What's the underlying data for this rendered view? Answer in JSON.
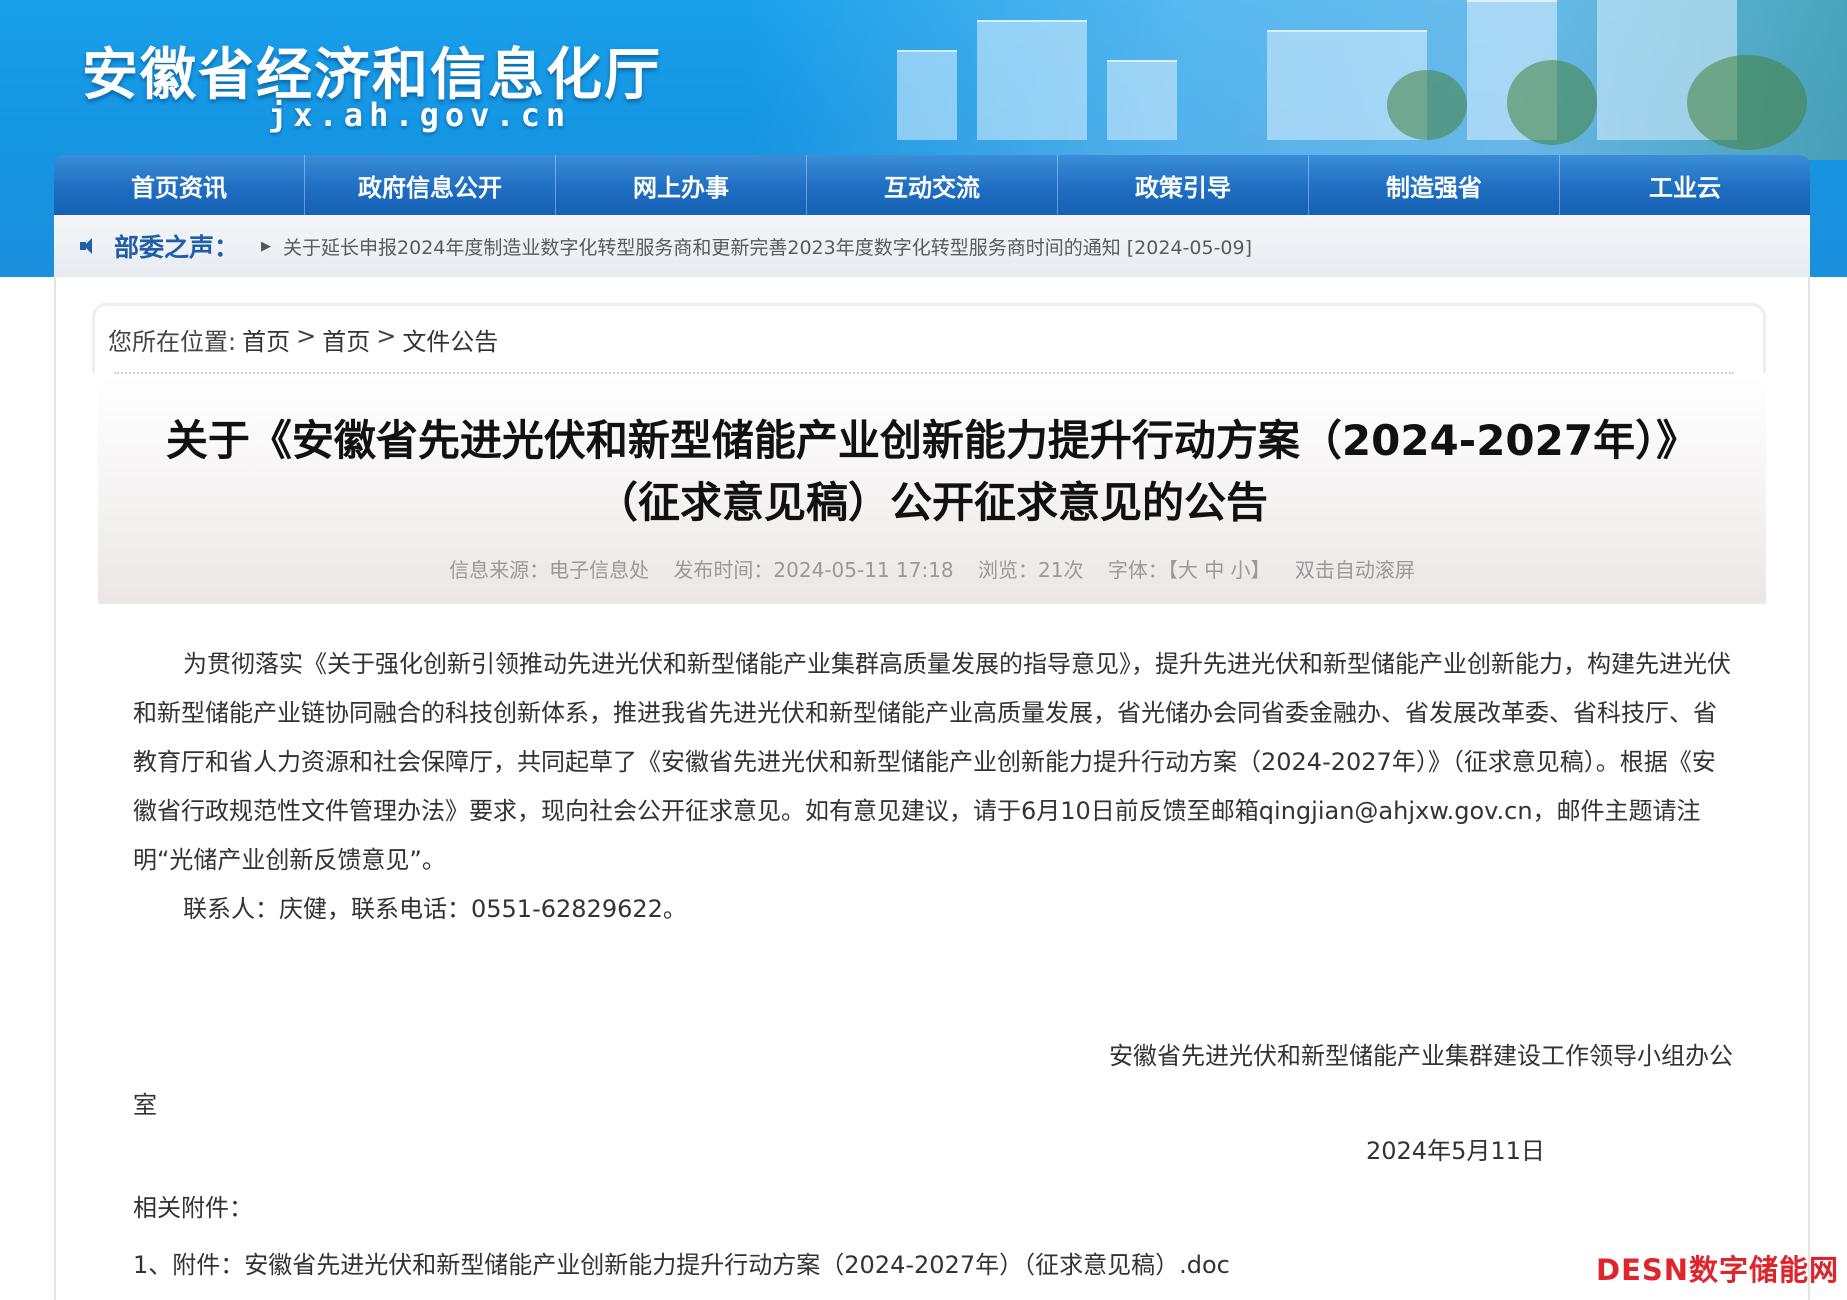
{
  "header": {
    "site_title": "安徽省经济和信息化厅",
    "site_domain": "jx.ah.gov.cn"
  },
  "nav": {
    "items": [
      "首页资讯",
      "政府信息公开",
      "网上办事",
      "互动交流",
      "政策引导",
      "制造强省",
      "工业云"
    ]
  },
  "notice": {
    "label": "部委之声：",
    "text": "关于延长申报2024年度制造业数字化转型服务商和更新完善2023年度数字化转型服务商时间的通知 [2024-05-09]"
  },
  "breadcrumb": {
    "prefix": "您所在位置:",
    "items": [
      "首页",
      "首页",
      "文件公告"
    ],
    "separator": ">"
  },
  "article": {
    "title_line1": "关于《安徽省先进光伏和新型储能产业创新能力提升行动方案（2024-2027年）》",
    "title_line2": "（征求意见稿）公开征求意见的公告",
    "meta": {
      "source": "信息来源：电子信息处",
      "published": "发布时间：2024-05-11 17:18",
      "views": "浏览：21次",
      "font_label": "字体：",
      "font_sizes": "【大 中 小】",
      "autoscroll": "双击自动滚屏"
    },
    "para1": "为贯彻落实《关于强化创新引领推动先进光伏和新型储能产业集群高质量发展的指导意见》，提升先进光伏和新型储能产业创新能力，构建先进光伏和新型储能产业链协同融合的科技创新体系，推进我省先进光伏和新型储能产业高质量发展，省光储办会同省委金融办、省发展改革委、省科技厅、省教育厅和省人力资源和社会保障厅，共同起草了《安徽省先进光伏和新型储能产业创新能力提升行动方案（2024-2027年）》（征求意见稿）。根据《安徽省行政规范性文件管理办法》要求，现向社会公开征求意见。如有意见建议，请于6月10日前反馈至邮箱qingjian@ahjxw.gov.cn，邮件主题请注明“光储产业创新反馈意见”。",
    "para2": "联系人：庆健，联系电话：0551-62829622。",
    "signature_line1": "安徽省先进光伏和新型储能产业集群建设工作领导小组办公",
    "signature_line2": "室",
    "date": "2024年5月11日",
    "attachments_label": "相关附件：",
    "attachments": [
      "1、附件：安徽省先进光伏和新型储能产业创新能力提升行动方案（2024-2027年）（征求意见稿）.doc"
    ]
  },
  "watermark": "DESN数字储能网",
  "colors": {
    "banner": "#1596e3",
    "nav": "#1f6ec2",
    "notice_label": "#1f5fa8",
    "watermark": "#e0242b"
  }
}
